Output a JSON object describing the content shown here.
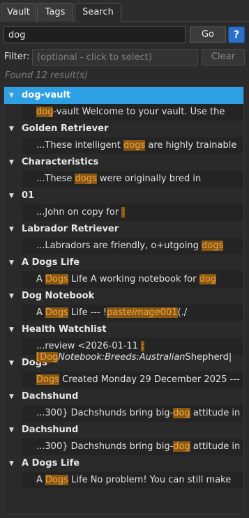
{
  "tabs": {
    "vault": "Vault",
    "tags": "Tags",
    "search": "Search"
  },
  "search": {
    "value": "dog",
    "go_label": "Go",
    "help_label": "?"
  },
  "filter": {
    "label": "Filter:",
    "placeholder": "(optional - click to select)",
    "clear_label": "Clear"
  },
  "status": "Found 12 result(s)",
  "colors": {
    "selected": "#2f9fe3",
    "highlight_bg": "#8a5a14",
    "highlight_fg": "#f0a040",
    "help": "#2d6fc9"
  },
  "results": [
    {
      "title": "dog-vault",
      "selected": true,
      "snippet": [
        {
          "t": "dog",
          "h": true
        },
        {
          "t": "-vault Welcome to your vault. Use the"
        }
      ]
    },
    {
      "title": "Golden Retriever",
      "snippet": [
        {
          "t": "...These intelligent "
        },
        {
          "t": "dogs",
          "h": true
        },
        {
          "t": " are highly trainable"
        }
      ]
    },
    {
      "title": "Characteristics",
      "snippet": [
        {
          "t": "...These "
        },
        {
          "t": "dogs",
          "h": true
        },
        {
          "t": " were originally bred in"
        }
      ]
    },
    {
      "title": "01",
      "snippet": [
        {
          "t": "...John on copy for "
        },
        {
          "t": ":",
          "h": true
        }
      ]
    },
    {
      "title": "Labrador Retriever",
      "snippet": [
        {
          "t": "...Labradors are friendly, o+utgoing "
        },
        {
          "t": "dogs",
          "h": true
        }
      ]
    },
    {
      "title": "A Dogs Life",
      "snippet": [
        {
          "t": "A "
        },
        {
          "t": "Dogs",
          "h": true
        },
        {
          "t": " Life A working notebook for "
        },
        {
          "t": "dog",
          "h": true
        }
      ]
    },
    {
      "title": "Dog Notebook",
      "snippet": [
        {
          "t": "A "
        },
        {
          "t": "Dogs",
          "h": true
        },
        {
          "t": " Life --- !"
        },
        {
          "t": "paste",
          "h": true
        },
        {
          "t": "image",
          "h": true,
          "i": true
        },
        {
          "t": "001",
          "h": true
        },
        {
          "t": "(./"
        }
      ]
    },
    {
      "title": "Health Watchlist",
      "snippet": [
        {
          "t": "...review <2026-01-11 "
        },
        {
          "t": ":",
          "h": true
        }
      ]
    },
    {
      "title": "Dogs",
      "snippet": [
        {
          "t": "Dogs",
          "h": true
        },
        {
          "t": " Created Monday 29 December 2025 ---"
        }
      ]
    },
    {
      "title": "Dachshund",
      "snippet": [
        {
          "t": "...300} Dachshunds bring big-"
        },
        {
          "t": "dog",
          "h": true
        },
        {
          "t": " attitude in"
        }
      ]
    },
    {
      "title": "Dachshund",
      "snippet": [
        {
          "t": "...300} Dachshunds bring big-"
        },
        {
          "t": "dog",
          "h": true
        },
        {
          "t": " attitude in"
        }
      ]
    },
    {
      "title": "A Dogs Life",
      "snippet": [
        {
          "t": "A "
        },
        {
          "t": "Dogs",
          "h": true
        },
        {
          "t": " Life No problem! You can still make"
        }
      ]
    }
  ],
  "extra_line_7": [
    {
      "t": "[",
      "h": true
    },
    {
      "t": "Dog",
      "h": true
    },
    {
      "t": "Notebook:Breeds:Australian",
      "i": true
    },
    {
      "t": "Shepherd|"
    }
  ]
}
